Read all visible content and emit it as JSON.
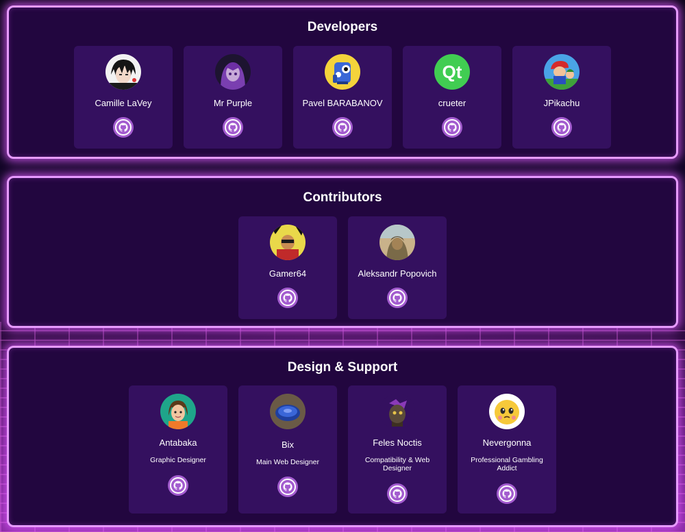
{
  "sections": [
    {
      "title": "Developers",
      "members": [
        {
          "name": "Camille LaVey",
          "avatar_icon": "anime-character-avatar-icon"
        },
        {
          "name": "Mr Purple",
          "avatar_icon": "purple-anime-character-avatar-icon"
        },
        {
          "name": "Pavel BARABANOV",
          "avatar_icon": "blue-robot-avatar-icon"
        },
        {
          "name": "crueter",
          "avatar_icon": "qt-logo-avatar-icon"
        },
        {
          "name": "JPikachu",
          "avatar_icon": "mario-avatar-icon"
        }
      ]
    },
    {
      "title": "Contributors",
      "members": [
        {
          "name": "Gamer64",
          "avatar_icon": "gamer-avatar-icon"
        },
        {
          "name": "Aleksandr Popovich",
          "avatar_icon": "desert-character-avatar-icon"
        }
      ]
    },
    {
      "title": "Design & Support",
      "members": [
        {
          "name": "Antabaka",
          "role": "Graphic Designer",
          "avatar_icon": "mii-avatar-icon"
        },
        {
          "name": "Bix",
          "role": "Main Web Designer",
          "avatar_icon": "blue-disc-avatar-icon"
        },
        {
          "name": "Feles Noctis",
          "role": "Compatibility & Web Designer",
          "avatar_icon": "purple-creature-avatar-icon"
        },
        {
          "name": "Nevergonna",
          "role": "Professional Gambling Addict",
          "avatar_icon": "yellow-emoji-avatar-icon"
        }
      ]
    }
  ],
  "github_icon": "github-icon",
  "colors": {
    "panel_bg": "#22063f",
    "card_bg": "#34105f",
    "panel_border": "#e79bff",
    "github_button": "#a35ccf"
  }
}
